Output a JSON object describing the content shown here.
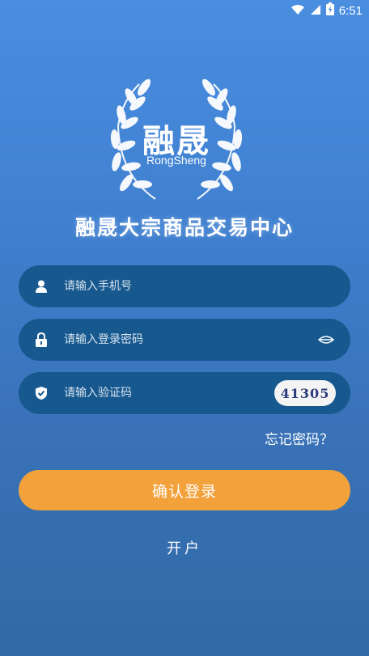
{
  "status_bar": {
    "time": "6:51",
    "icons": [
      "wifi-icon",
      "signal-icon",
      "battery-charging-icon"
    ]
  },
  "logo": {
    "cn": "融晟",
    "en": "RongSheng",
    "decoration": "laurel-wreath-icon"
  },
  "app_title": "融晟大宗商品交易中心",
  "form": {
    "phone": {
      "placeholder": "请输入手机号",
      "value": "",
      "icon": "user-icon"
    },
    "password": {
      "placeholder": "请输入登录密码",
      "value": "",
      "icon": "lock-icon",
      "toggle_icon": "eye-closed-icon"
    },
    "captcha": {
      "placeholder": "请输入验证码",
      "value": "",
      "icon": "shield-check-icon",
      "image_text": "41305"
    }
  },
  "forgot_password": "忘记密码？",
  "login_button": "确认登录",
  "register_link": "开户",
  "colors": {
    "background_top": "#4a8ee0",
    "background_bottom": "#2f6aa5",
    "field_bg": "#17598f",
    "button": "#f3a13a"
  }
}
